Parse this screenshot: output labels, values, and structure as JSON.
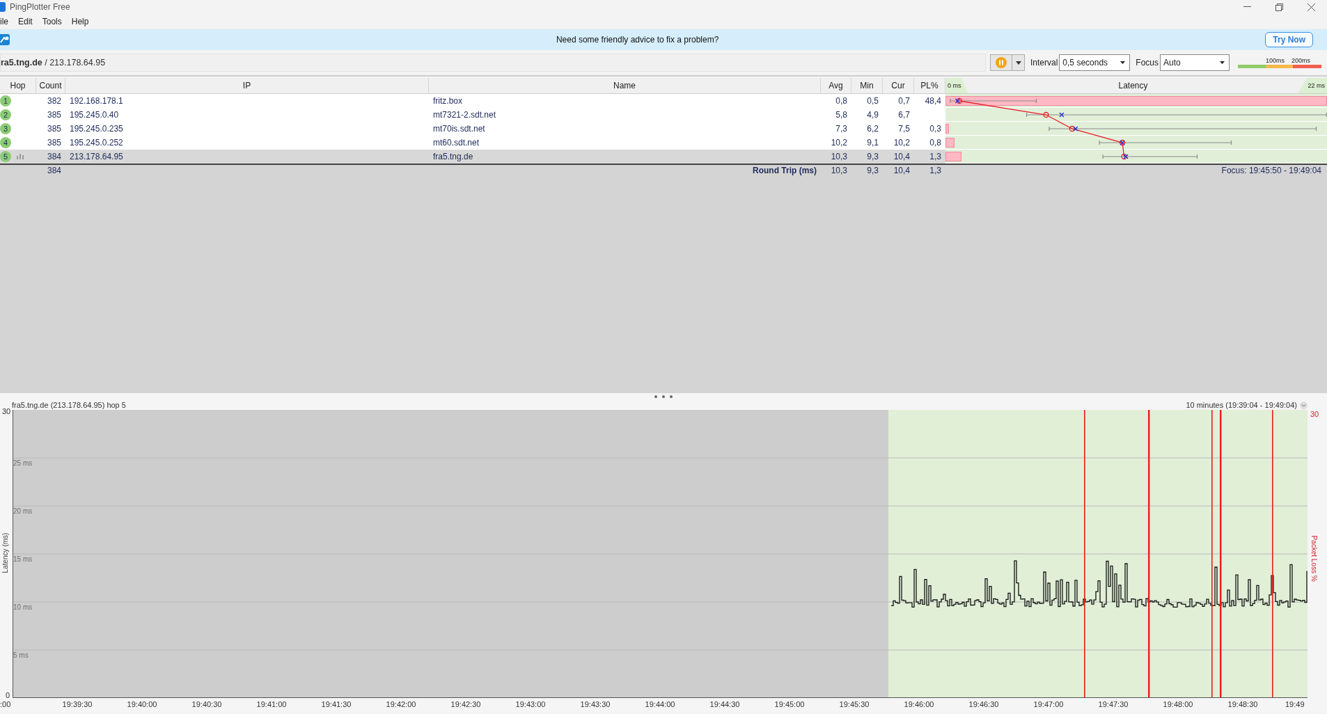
{
  "window": {
    "title": "PingPlotter Free"
  },
  "menu": [
    "ile",
    "Edit",
    "Tools",
    "Help"
  ],
  "banner": {
    "message": "Need some friendly advice to fix a problem?",
    "button": "Try Now"
  },
  "toolbar": {
    "target": "**ra5.tng.de** / 213.178.64.95",
    "interval_label": "Interval",
    "interval": "0,5 seconds",
    "focus_label": "Focus",
    "focus": "Auto",
    "scale_labels": [
      "100ms",
      "200ms"
    ]
  },
  "table": {
    "columns": [
      "Hop",
      "Count",
      "IP",
      "Name",
      "Avg",
      "Min",
      "Cur",
      "PL%",
      "Latency"
    ],
    "latency_range": [
      "0 ms",
      "22 ms"
    ],
    "rows": [
      {
        "hop": "1",
        "count": "382",
        "ip": "192.168.178.1",
        "name": "fritz.box",
        "avg": "0,8",
        "min": "0,5",
        "cur": "0,7",
        "pl": "48,4",
        "level": 1,
        "graphed": false,
        "selected": false
      },
      {
        "hop": "2",
        "count": "385",
        "ip": "195.245.0.40",
        "name": "mt7321-2.sdt.net",
        "avg": "5,8",
        "min": "4,9",
        "cur": "6,7",
        "graphed": false,
        "selected": false
      },
      {
        "hop": "3",
        "count": "385",
        "ip": "195.245.0.235",
        "name": "mt70is.sdt.net",
        "avg": "7,3",
        "min": "6,2",
        "cur": "7,5",
        "pl": "0,3",
        "level": 0.009,
        "graphed": false,
        "selected": false
      },
      {
        "hop": "4",
        "count": "385",
        "ip": "195.245.0.252",
        "name": "mt60.sdt.net",
        "avg": "10,2",
        "min": "9,1",
        "cur": "10,2",
        "pl": "0,8",
        "level": 0.024,
        "graphed": false,
        "selected": false
      },
      {
        "hop": "5",
        "count": "384",
        "ip": "213.178.64.95",
        "name": "fra5.tng.de",
        "avg": "10,3",
        "min": "9,3",
        "cur": "10,4",
        "pl": "1,3",
        "level": 0.042,
        "graphed": true,
        "selected": true
      }
    ],
    "summary": {
      "count": "384",
      "label": "Round Trip (ms)",
      "avg": "10,3",
      "min": "9,3",
      "cur": "10,4",
      "pl": "1,3",
      "focus": "Focus: 19:45:50 - 19:49:04"
    }
  },
  "graph": {
    "title": "fra5.tng.de (213.178.64.95) hop 5",
    "range": "10 minutes (19:39:04 - 19:49:04)",
    "ylabel": "Latency (ms)",
    "y_max": "30",
    "y_min": "0",
    "grid_labels": [
      "25 ms",
      "20 ms",
      "15 ms",
      "10 ms",
      "5 ms"
    ],
    "y2label": "Packet Loss %",
    "y2_max": "30",
    "x_labels": [
      ":00",
      "19:39:30",
      "19:40:00",
      "19:40:30",
      "19:41:00",
      "19:41:30",
      "19:42:00",
      "19:42:30",
      "19:43:00",
      "19:43:30",
      "19:44:00",
      "19:44:30",
      "19:45:00",
      "19:45:30",
      "19:46:00",
      "19:46:30",
      "19:47:00",
      "19:47:30",
      "19:48:00",
      "19:48:30",
      "19:49"
    ]
  }
}
